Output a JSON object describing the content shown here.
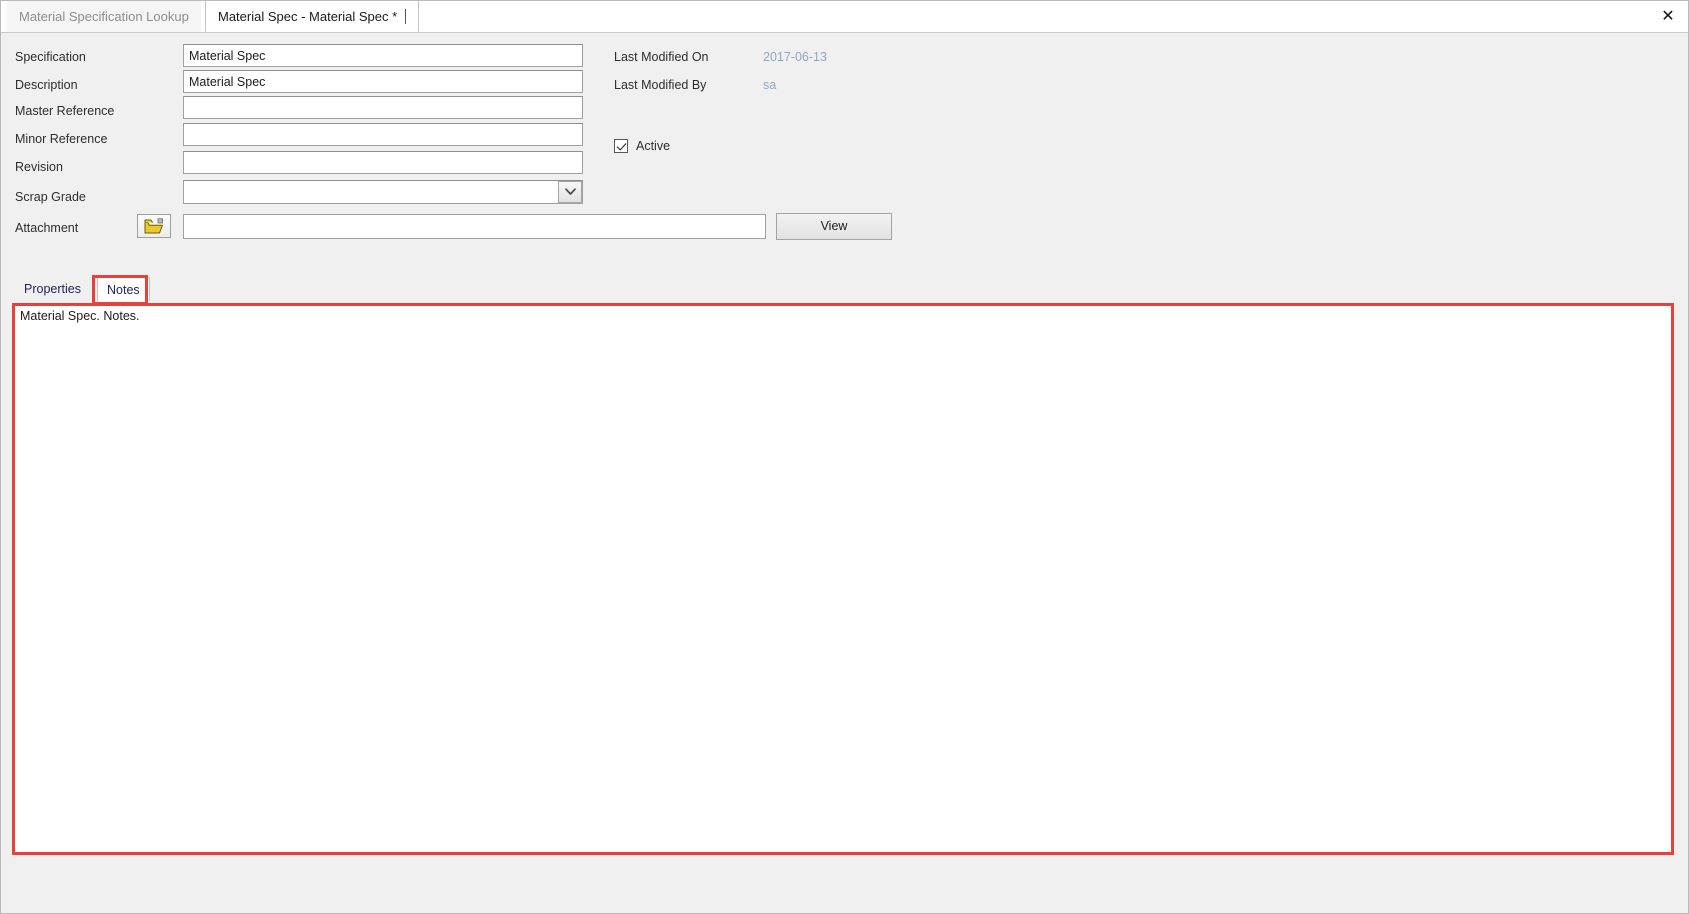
{
  "window": {
    "close_label": "✕"
  },
  "tabstrip": {
    "tabs": [
      {
        "label": "Material Specification Lookup",
        "active": false
      },
      {
        "label": "Material Spec - Material Spec *",
        "active": true
      }
    ]
  },
  "form": {
    "fields": [
      {
        "label": "Specification",
        "value": "Material Spec",
        "placeholder": ""
      },
      {
        "label": "Description",
        "value": "Material Spec",
        "placeholder": ""
      },
      {
        "label": "Master Reference",
        "value": "",
        "placeholder": ""
      },
      {
        "label": "Minor Reference",
        "value": "",
        "placeholder": ""
      },
      {
        "label": "Revision",
        "value": "",
        "placeholder": ""
      }
    ],
    "scrap_grade": {
      "label": "Scrap Grade",
      "value": "",
      "placeholder": "",
      "dropdown_icon": "chevron-down-icon"
    },
    "attachment": {
      "label": "Attachment",
      "value": "",
      "placeholder": "",
      "browse_icon": "open-folder-icon",
      "view_button": "View"
    },
    "meta": {
      "last_modified_on_label": "Last Modified On",
      "last_modified_on_value": "2017-06-13",
      "last_modified_by_label": "Last Modified By",
      "last_modified_by_value": "sa",
      "active_label": "Active",
      "active_checked": true
    }
  },
  "inner_tabs": {
    "tabs": [
      {
        "label": "Properties",
        "active": false
      },
      {
        "label": "Notes",
        "active": true
      }
    ]
  },
  "notes": {
    "value": "Material Spec. Notes.",
    "placeholder": ""
  },
  "colors": {
    "highlight": "#e8413a",
    "form_background": "#f0f0f0",
    "meta_value_text": "#8fa8c8",
    "tab_text": "#23235c",
    "folder_icon": "#e8c92e"
  }
}
